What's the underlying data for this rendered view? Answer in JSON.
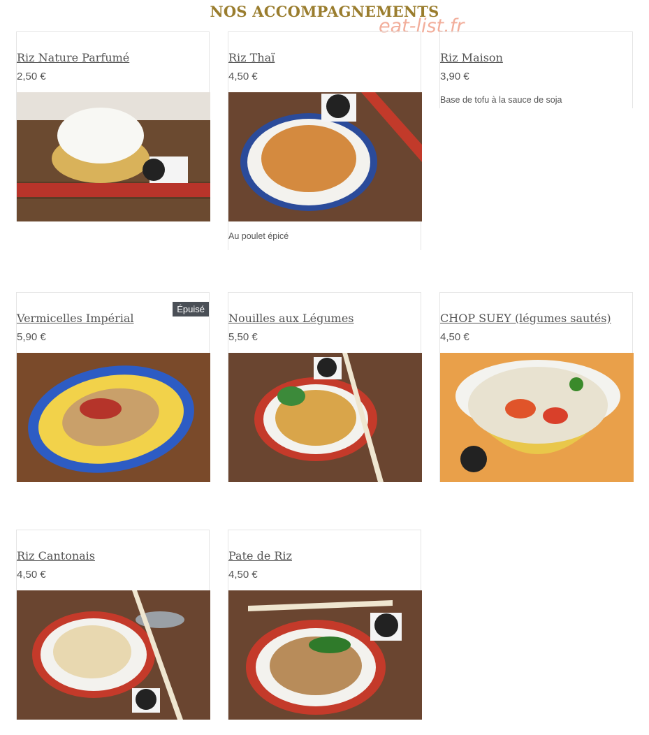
{
  "section": {
    "title": "NOS ACCOMPAGNEMENTS",
    "watermark": "eat-list.fr"
  },
  "items": [
    {
      "title": "Riz Nature Parfumé",
      "price": "2,50 €",
      "description": "",
      "badge": ""
    },
    {
      "title": "Riz Thaï",
      "price": "4,50 €",
      "description": "Au poulet épicé",
      "badge": ""
    },
    {
      "title": "Riz Maison",
      "price": "3,90 €",
      "description": "Base de tofu à la sauce de soja",
      "badge": ""
    },
    {
      "title": "Vermicelles Impérial",
      "price": "5,90 €",
      "description": "",
      "badge": "Épuisé"
    },
    {
      "title": "Nouilles aux Légumes",
      "price": "5,50 €",
      "description": "",
      "badge": ""
    },
    {
      "title": "CHOP SUEY (légumes sautés)",
      "price": "4,50 €",
      "description": "",
      "badge": ""
    },
    {
      "title": "Riz Cantonais",
      "price": "4,50 €",
      "description": "",
      "badge": ""
    },
    {
      "title": "Pate de Riz",
      "price": "4,50 €",
      "description": "",
      "badge": ""
    }
  ],
  "colors": {
    "title": "#9a7d2e",
    "badge_bg": "#4a4f56",
    "wood": "#6b4a30",
    "watermark": "#f0a08a"
  }
}
